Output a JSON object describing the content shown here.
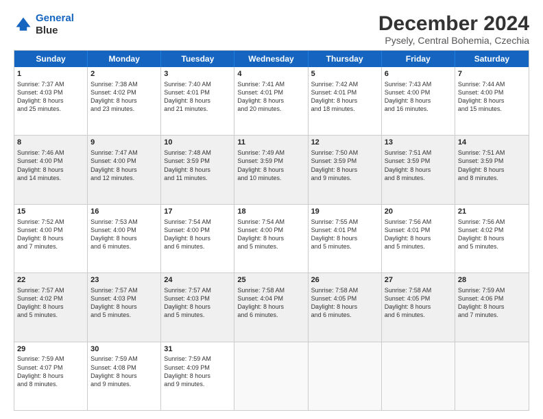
{
  "logo": {
    "line1": "General",
    "line2": "Blue"
  },
  "title": "December 2024",
  "subtitle": "Pysely, Central Bohemia, Czechia",
  "header": {
    "days": [
      "Sunday",
      "Monday",
      "Tuesday",
      "Wednesday",
      "Thursday",
      "Friday",
      "Saturday"
    ]
  },
  "weeks": [
    {
      "cells": [
        {
          "day": "1",
          "lines": [
            "Sunrise: 7:37 AM",
            "Sunset: 4:03 PM",
            "Daylight: 8 hours",
            "and 25 minutes."
          ]
        },
        {
          "day": "2",
          "lines": [
            "Sunrise: 7:38 AM",
            "Sunset: 4:02 PM",
            "Daylight: 8 hours",
            "and 23 minutes."
          ]
        },
        {
          "day": "3",
          "lines": [
            "Sunrise: 7:40 AM",
            "Sunset: 4:01 PM",
            "Daylight: 8 hours",
            "and 21 minutes."
          ]
        },
        {
          "day": "4",
          "lines": [
            "Sunrise: 7:41 AM",
            "Sunset: 4:01 PM",
            "Daylight: 8 hours",
            "and 20 minutes."
          ]
        },
        {
          "day": "5",
          "lines": [
            "Sunrise: 7:42 AM",
            "Sunset: 4:01 PM",
            "Daylight: 8 hours",
            "and 18 minutes."
          ]
        },
        {
          "day": "6",
          "lines": [
            "Sunrise: 7:43 AM",
            "Sunset: 4:00 PM",
            "Daylight: 8 hours",
            "and 16 minutes."
          ]
        },
        {
          "day": "7",
          "lines": [
            "Sunrise: 7:44 AM",
            "Sunset: 4:00 PM",
            "Daylight: 8 hours",
            "and 15 minutes."
          ]
        }
      ]
    },
    {
      "cells": [
        {
          "day": "8",
          "lines": [
            "Sunrise: 7:46 AM",
            "Sunset: 4:00 PM",
            "Daylight: 8 hours",
            "and 14 minutes."
          ]
        },
        {
          "day": "9",
          "lines": [
            "Sunrise: 7:47 AM",
            "Sunset: 4:00 PM",
            "Daylight: 8 hours",
            "and 12 minutes."
          ]
        },
        {
          "day": "10",
          "lines": [
            "Sunrise: 7:48 AM",
            "Sunset: 3:59 PM",
            "Daylight: 8 hours",
            "and 11 minutes."
          ]
        },
        {
          "day": "11",
          "lines": [
            "Sunrise: 7:49 AM",
            "Sunset: 3:59 PM",
            "Daylight: 8 hours",
            "and 10 minutes."
          ]
        },
        {
          "day": "12",
          "lines": [
            "Sunrise: 7:50 AM",
            "Sunset: 3:59 PM",
            "Daylight: 8 hours",
            "and 9 minutes."
          ]
        },
        {
          "day": "13",
          "lines": [
            "Sunrise: 7:51 AM",
            "Sunset: 3:59 PM",
            "Daylight: 8 hours",
            "and 8 minutes."
          ]
        },
        {
          "day": "14",
          "lines": [
            "Sunrise: 7:51 AM",
            "Sunset: 3:59 PM",
            "Daylight: 8 hours",
            "and 8 minutes."
          ]
        }
      ]
    },
    {
      "cells": [
        {
          "day": "15",
          "lines": [
            "Sunrise: 7:52 AM",
            "Sunset: 4:00 PM",
            "Daylight: 8 hours",
            "and 7 minutes."
          ]
        },
        {
          "day": "16",
          "lines": [
            "Sunrise: 7:53 AM",
            "Sunset: 4:00 PM",
            "Daylight: 8 hours",
            "and 6 minutes."
          ]
        },
        {
          "day": "17",
          "lines": [
            "Sunrise: 7:54 AM",
            "Sunset: 4:00 PM",
            "Daylight: 8 hours",
            "and 6 minutes."
          ]
        },
        {
          "day": "18",
          "lines": [
            "Sunrise: 7:54 AM",
            "Sunset: 4:00 PM",
            "Daylight: 8 hours",
            "and 5 minutes."
          ]
        },
        {
          "day": "19",
          "lines": [
            "Sunrise: 7:55 AM",
            "Sunset: 4:01 PM",
            "Daylight: 8 hours",
            "and 5 minutes."
          ]
        },
        {
          "day": "20",
          "lines": [
            "Sunrise: 7:56 AM",
            "Sunset: 4:01 PM",
            "Daylight: 8 hours",
            "and 5 minutes."
          ]
        },
        {
          "day": "21",
          "lines": [
            "Sunrise: 7:56 AM",
            "Sunset: 4:02 PM",
            "Daylight: 8 hours",
            "and 5 minutes."
          ]
        }
      ]
    },
    {
      "cells": [
        {
          "day": "22",
          "lines": [
            "Sunrise: 7:57 AM",
            "Sunset: 4:02 PM",
            "Daylight: 8 hours",
            "and 5 minutes."
          ]
        },
        {
          "day": "23",
          "lines": [
            "Sunrise: 7:57 AM",
            "Sunset: 4:03 PM",
            "Daylight: 8 hours",
            "and 5 minutes."
          ]
        },
        {
          "day": "24",
          "lines": [
            "Sunrise: 7:57 AM",
            "Sunset: 4:03 PM",
            "Daylight: 8 hours",
            "and 5 minutes."
          ]
        },
        {
          "day": "25",
          "lines": [
            "Sunrise: 7:58 AM",
            "Sunset: 4:04 PM",
            "Daylight: 8 hours",
            "and 6 minutes."
          ]
        },
        {
          "day": "26",
          "lines": [
            "Sunrise: 7:58 AM",
            "Sunset: 4:05 PM",
            "Daylight: 8 hours",
            "and 6 minutes."
          ]
        },
        {
          "day": "27",
          "lines": [
            "Sunrise: 7:58 AM",
            "Sunset: 4:05 PM",
            "Daylight: 8 hours",
            "and 6 minutes."
          ]
        },
        {
          "day": "28",
          "lines": [
            "Sunrise: 7:59 AM",
            "Sunset: 4:06 PM",
            "Daylight: 8 hours",
            "and 7 minutes."
          ]
        }
      ]
    },
    {
      "cells": [
        {
          "day": "29",
          "lines": [
            "Sunrise: 7:59 AM",
            "Sunset: 4:07 PM",
            "Daylight: 8 hours",
            "and 8 minutes."
          ]
        },
        {
          "day": "30",
          "lines": [
            "Sunrise: 7:59 AM",
            "Sunset: 4:08 PM",
            "Daylight: 8 hours",
            "and 9 minutes."
          ]
        },
        {
          "day": "31",
          "lines": [
            "Sunrise: 7:59 AM",
            "Sunset: 4:09 PM",
            "Daylight: 8 hours",
            "and 9 minutes."
          ]
        },
        {
          "day": "",
          "lines": []
        },
        {
          "day": "",
          "lines": []
        },
        {
          "day": "",
          "lines": []
        },
        {
          "day": "",
          "lines": []
        }
      ]
    }
  ]
}
